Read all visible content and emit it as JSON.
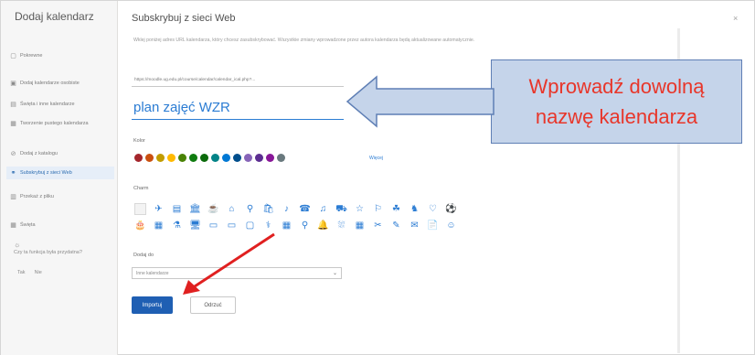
{
  "sidebar": {
    "title": "Dodaj kalendarz",
    "items": [
      {
        "label": "Pokrewne",
        "icon": "calendar-icon"
      },
      {
        "label": "Dodaj kalendarze osobiste",
        "icon": "calendar-add-icon"
      },
      {
        "label": "Święta i inne kalendarze",
        "icon": "holiday-icon"
      },
      {
        "label": "Tworzenie pustego kalendarza",
        "icon": "blank-calendar-icon"
      },
      {
        "label": "Dodaj z katalogu",
        "icon": "directory-icon"
      },
      {
        "label": "Subskrybuj z sieci Web",
        "icon": "link-icon",
        "active": true
      },
      {
        "label": "Przekaż z pliku",
        "icon": "file-icon"
      },
      {
        "label": "Święta",
        "icon": "flag-icon"
      }
    ],
    "question": "Czy ta funkcja była przydatna?",
    "yes": "Tak",
    "no": "Nie"
  },
  "panel": {
    "title": "Subskrybuj z sieci Web",
    "close": "×",
    "description": "Wklej poniżej adres URL kalendarza, który chcesz zasubskrybować. Wszystkie zmiany wprowadzone przez autora kalendarza będą aktualizowane automatycznie.",
    "url_value": "https://moodle.ug.edu.pl/course/calendar/calendar_ical.php?...",
    "name_value": "plan zajęć WZR",
    "color_label": "Kolor",
    "more_colors": "Więcej",
    "charms_label": "Charm",
    "add_to_label": "Dodaj do",
    "add_to_value": "Inne kalendarze",
    "import_button": "Importuj",
    "cancel_button": "Odrzuć"
  },
  "colors": [
    "#a4262c",
    "#ca5010",
    "#c19c00",
    "#ffb900",
    "#498205",
    "#107c10",
    "#0b6a0b",
    "#038387",
    "#0078d4",
    "#004e8c",
    "#8764b8",
    "#5c2e91",
    "#881798",
    "#69797e"
  ],
  "charms": {
    "row1": [
      "",
      "✈",
      "▤",
      "🏛",
      "☕",
      "⌂",
      "⚲",
      "🛍",
      "♪",
      "☎",
      "♫",
      "⛟",
      "☆",
      "⚐",
      "☘",
      "♞",
      "♡",
      "⚽"
    ],
    "row2": [
      "🎂",
      "▦",
      "⚗",
      "🖥",
      "▭",
      "▭",
      "▢",
      "⚕",
      "▦",
      "⚲",
      "🔔",
      "⛆",
      "▦",
      "✂",
      "✎",
      "✉",
      "📄",
      "☺"
    ]
  },
  "annotation": {
    "line1": "Wprowadź dowolną",
    "line2": "nazwę kalendarza"
  }
}
